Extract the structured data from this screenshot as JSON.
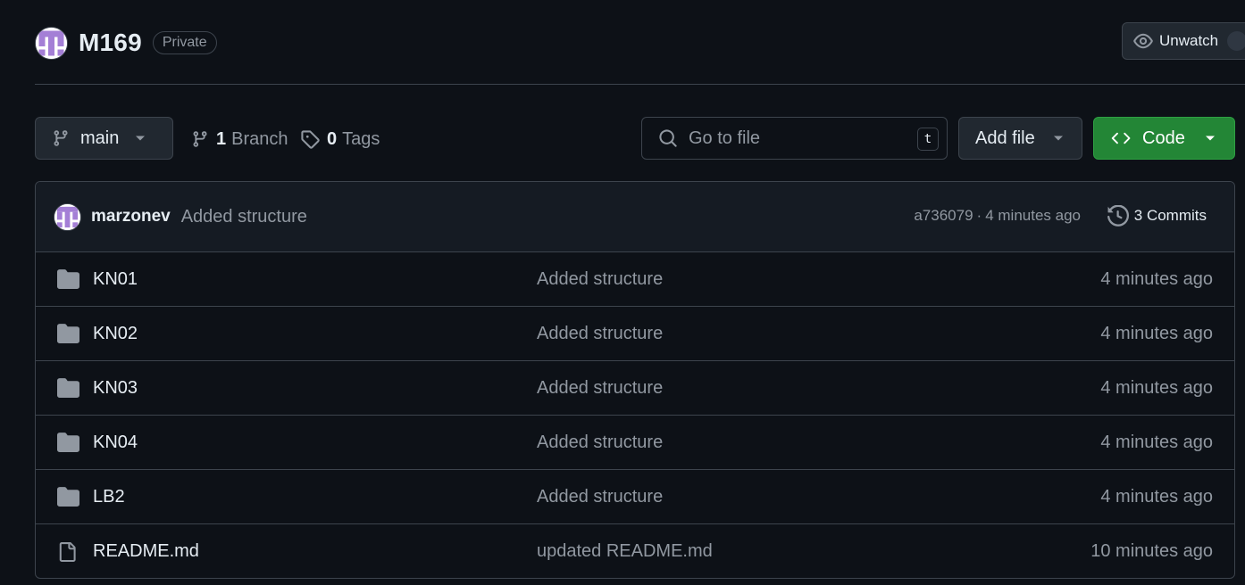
{
  "repo": {
    "name": "M169",
    "visibility": "Private",
    "avatar_icon": "identicon-avatar"
  },
  "header": {
    "unwatch_label": "Unwatch",
    "watch_icon": "eye-icon"
  },
  "toolbar": {
    "branch_name": "main",
    "branch_count": "1",
    "branch_label": "Branch",
    "tag_count": "0",
    "tag_label": "Tags",
    "search_placeholder": "Go to file",
    "search_shortcut": "t",
    "add_file_label": "Add file",
    "code_label": "Code"
  },
  "latest_commit": {
    "author": "marzonev",
    "message": "Added structure",
    "hash": "a736079",
    "separator": "·",
    "time": "4 minutes ago",
    "commits_label": "3 Commits"
  },
  "files": [
    {
      "type": "folder",
      "icon": "folder-icon",
      "name": "KN01",
      "message": "Added structure",
      "age": "4 minutes ago"
    },
    {
      "type": "folder",
      "icon": "folder-icon",
      "name": "KN02",
      "message": "Added structure",
      "age": "4 minutes ago"
    },
    {
      "type": "folder",
      "icon": "folder-icon",
      "name": "KN03",
      "message": "Added structure",
      "age": "4 minutes ago"
    },
    {
      "type": "folder",
      "icon": "folder-icon",
      "name": "KN04",
      "message": "Added structure",
      "age": "4 minutes ago"
    },
    {
      "type": "folder",
      "icon": "folder-icon",
      "name": "LB2",
      "message": "Added structure",
      "age": "4 minutes ago"
    },
    {
      "type": "file",
      "icon": "file-icon",
      "name": "README.md",
      "message": "updated README.md",
      "age": "10 minutes ago"
    }
  ],
  "colors": {
    "background": "#0d1117",
    "border": "#3d444d",
    "muted_text": "#9198a1",
    "primary_button": "#238636",
    "avatar_purple": "#a47fd6"
  }
}
